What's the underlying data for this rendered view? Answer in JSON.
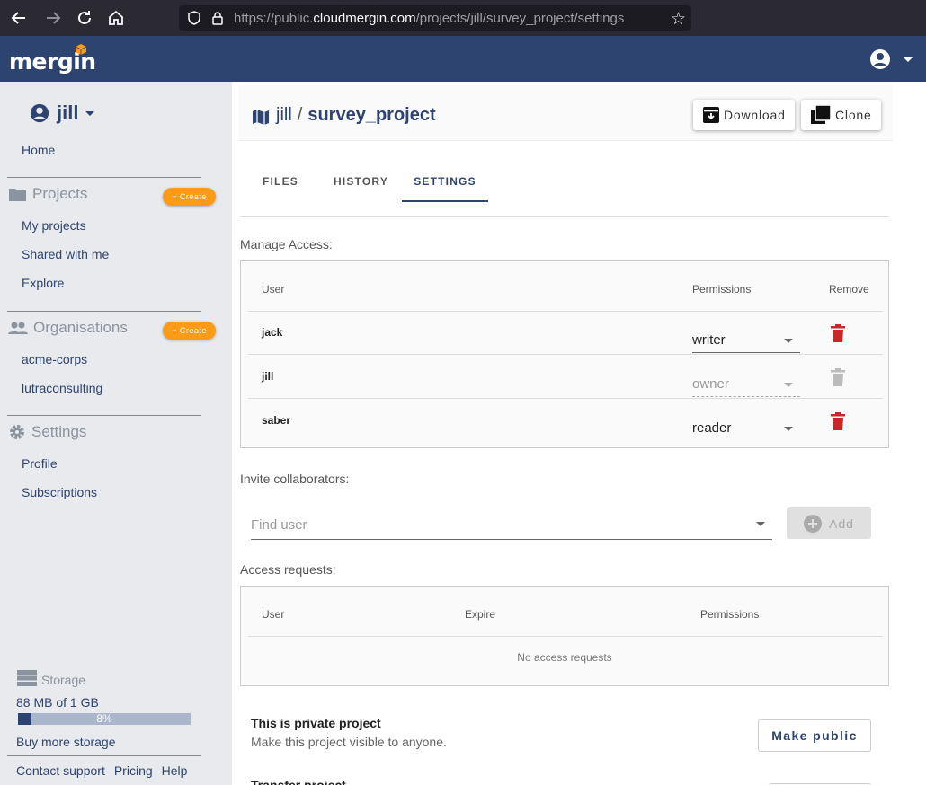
{
  "browser": {
    "url_prefix": "https://public.",
    "url_domain": "cloudmergin.com",
    "url_path": "/projects/jill/survey_project/settings"
  },
  "header": {
    "logo": "mergin"
  },
  "sidebar": {
    "user": "jill",
    "home": "Home",
    "projects_label": "Projects",
    "create_label": "+ Create",
    "projects_items": [
      "My projects",
      "Shared with me",
      "Explore"
    ],
    "orgs_label": "Organisations",
    "orgs_items": [
      "acme-corps",
      "lutraconsulting"
    ],
    "settings_label": "Settings",
    "settings_items": [
      "Profile",
      "Subscriptions"
    ],
    "storage": {
      "label": "Storage",
      "used": "88 MB of 1 GB",
      "percent_text": "8%",
      "percent": 8,
      "buy": "Buy more storage"
    },
    "footer": [
      "Contact support",
      "Pricing",
      "Help"
    ]
  },
  "project": {
    "owner": "jill",
    "separator": "/",
    "name": "survey_project",
    "download": "Download",
    "clone": "Clone"
  },
  "tabs": [
    "FILES",
    "HISTORY",
    "SETTINGS"
  ],
  "manage_access": {
    "label": "Manage Access:",
    "headers": {
      "user": "User",
      "permissions": "Permissions",
      "remove": "Remove"
    },
    "rows": [
      {
        "user": "jack",
        "permission": "writer"
      },
      {
        "user": "jill",
        "permission": "owner"
      },
      {
        "user": "saber",
        "permission": "reader"
      }
    ]
  },
  "invite": {
    "label": "Invite collaborators:",
    "placeholder": "Find user",
    "add": "Add"
  },
  "access_requests": {
    "label": "Access requests:",
    "headers": {
      "user": "User",
      "expire": "Expire",
      "permissions": "Permissions"
    },
    "empty": "No access requests"
  },
  "privacy": {
    "title": "This is private project",
    "subtitle": "Make this project visible to anyone.",
    "button": "Make public"
  },
  "transfer": {
    "title": "Transfer project"
  },
  "colors": {
    "brand": "#2d4470",
    "accent": "#fd9a16",
    "danger": "#c62828"
  }
}
